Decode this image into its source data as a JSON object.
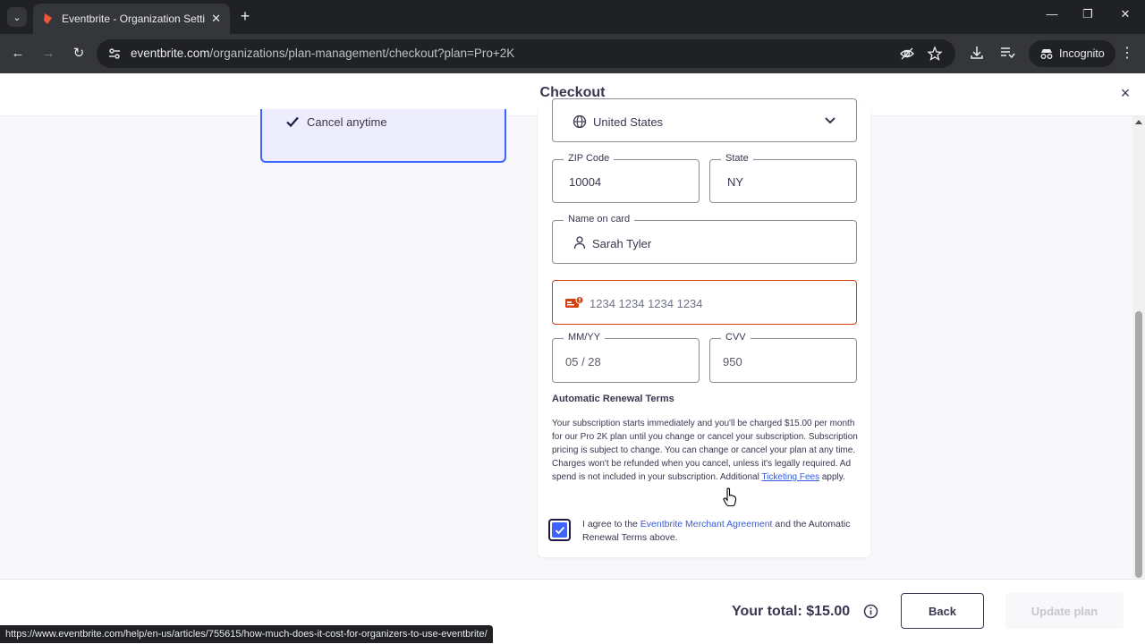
{
  "browser": {
    "tab_title": "Eventbrite - Organization Settin",
    "tab_close": "✕",
    "new_tab": "+",
    "url_host": "eventbrite.com",
    "url_path": "/organizations/plan-management/checkout?plan=Pro+2K",
    "incognito_label": "Incognito",
    "status_url": "https://www.eventbrite.com/help/en-us/articles/755615/how-much-does-it-cost-for-organizers-to-use-eventbrite/",
    "icons": [
      "tab-search-icon",
      "eventbrite-favicon",
      "back-icon",
      "forward-icon",
      "reload-icon",
      "site-info-icon",
      "eye-off-icon",
      "star-icon",
      "download-icon",
      "reading-list-icon",
      "incognito-icon",
      "kebab-menu-icon",
      "minimize-icon",
      "restore-icon",
      "close-window-icon"
    ]
  },
  "checkout": {
    "title": "Checkout",
    "close": "×"
  },
  "plan_card": {
    "feature": "Cancel anytime"
  },
  "form": {
    "country": "United States",
    "zip": {
      "label": "ZIP Code",
      "value": "10004"
    },
    "state": {
      "label": "State",
      "value": "NY"
    },
    "name_on_card": {
      "label": "Name on card",
      "value": "Sarah Tyler"
    },
    "card_number": {
      "placeholder": "1234 1234 1234 1234"
    },
    "expiry": {
      "label": "MM/YY",
      "value": "05 / 28"
    },
    "cvv": {
      "label": "CVV",
      "value": "950"
    },
    "colors": {
      "error": "#d1410c",
      "accent": "#3d64ff",
      "link": "#3659e3"
    }
  },
  "terms": {
    "title": "Automatic Renewal Terms",
    "body": "Your subscription starts immediately and you'll be charged $15.00 per month for our Pro 2K plan until you change or cancel your subscription. Subscription pricing is subject to change. You can change or cancel your plan at any time. Charges won't be refunded when you cancel, unless it's legally required. Ad spend is not included in your subscription. Additional",
    "link": "Ticketing Fees",
    "tail": " apply."
  },
  "agreement": {
    "checked": true,
    "prefix": "I agree to the ",
    "link": "Eventbrite Merchant Agreement",
    "suffix": " and the Automatic Renewal Terms above."
  },
  "footer": {
    "total": "Your total: $15.00",
    "back": "Back",
    "update": "Update plan"
  }
}
